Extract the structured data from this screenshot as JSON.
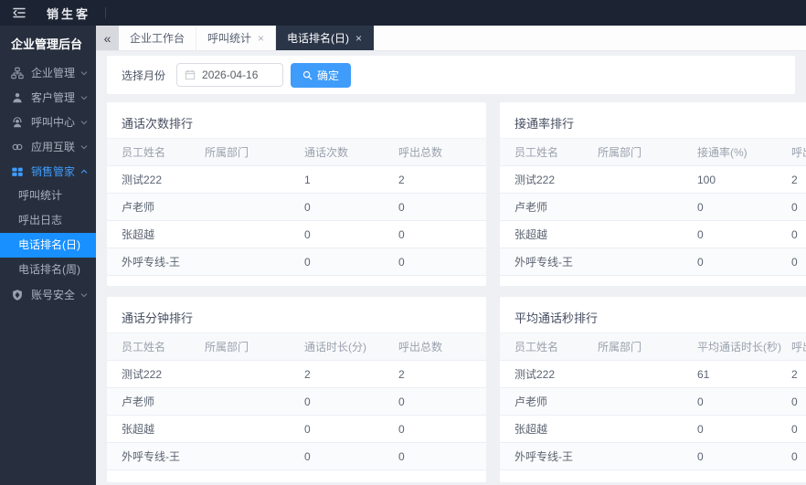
{
  "topbar": {
    "brand": "销生客"
  },
  "sidebar": {
    "title": "企业管理后台",
    "items": [
      {
        "label": "企业管理",
        "icon": "org-icon"
      },
      {
        "label": "客户管理",
        "icon": "user-icon"
      },
      {
        "label": "呼叫中心",
        "icon": "agent-icon"
      },
      {
        "label": "应用互联",
        "icon": "link-icon"
      },
      {
        "label": "销售管家",
        "icon": "grid-icon",
        "expanded": true,
        "active": true,
        "children": [
          {
            "label": "呼叫统计"
          },
          {
            "label": "呼出日志"
          },
          {
            "label": "电话排名(日)",
            "active": true
          },
          {
            "label": "电话排名(周)"
          }
        ]
      },
      {
        "label": "账号安全",
        "icon": "shield-icon"
      }
    ]
  },
  "tabbar": {
    "collapse_glyph": "«",
    "tabs": [
      {
        "label": "企业工作台",
        "closable": false
      },
      {
        "label": "呼叫统计",
        "closable": true,
        "close_glyph": "×"
      },
      {
        "label": "电话排名(日)",
        "closable": true,
        "close_glyph": "×",
        "active": true
      }
    ]
  },
  "filter": {
    "label": "选择月份",
    "date_value": "2026-04-16",
    "submit_label": "确定"
  },
  "panels": [
    {
      "title": "通话次数排行",
      "columns": [
        "员工姓名",
        "所属部门",
        "通话次数",
        "呼出总数"
      ],
      "rows": [
        [
          "测试222",
          "",
          "1",
          "2"
        ],
        [
          "卢老师",
          "",
          "0",
          "0"
        ],
        [
          "张超越",
          "",
          "0",
          "0"
        ],
        [
          "外呼专线-王",
          "",
          "0",
          "0"
        ]
      ]
    },
    {
      "title": "接通率排行",
      "columns": [
        "员工姓名",
        "所属部门",
        "接通率(%)",
        "呼出总数"
      ],
      "rows": [
        [
          "测试222",
          "",
          "100",
          "2"
        ],
        [
          "卢老师",
          "",
          "0",
          "0"
        ],
        [
          "张超越",
          "",
          "0",
          "0"
        ],
        [
          "外呼专线-王",
          "",
          "0",
          "0"
        ]
      ]
    },
    {
      "title": "通话分钟排行",
      "columns": [
        "员工姓名",
        "所属部门",
        "通话时长(分)",
        "呼出总数"
      ],
      "rows": [
        [
          "测试222",
          "",
          "2",
          "2"
        ],
        [
          "卢老师",
          "",
          "0",
          "0"
        ],
        [
          "张超越",
          "",
          "0",
          "0"
        ],
        [
          "外呼专线-王",
          "",
          "0",
          "0"
        ]
      ]
    },
    {
      "title": "平均通话秒排行",
      "columns": [
        "员工姓名",
        "所属部门",
        "平均通话时长(秒)",
        "呼出总数"
      ],
      "rows": [
        [
          "测试222",
          "",
          "61",
          "2"
        ],
        [
          "卢老师",
          "",
          "0",
          "0"
        ],
        [
          "张超越",
          "",
          "0",
          "0"
        ],
        [
          "外呼专线-王",
          "",
          "0",
          "0"
        ]
      ]
    }
  ],
  "colors": {
    "accent_blue": "#1890ff",
    "button_blue": "#3f9cfb",
    "topbar_bg": "#1c2433",
    "sidebar_bg": "#272f3e",
    "active_tab_bg": "#2a3547",
    "page_bg": "#eef0f4"
  }
}
